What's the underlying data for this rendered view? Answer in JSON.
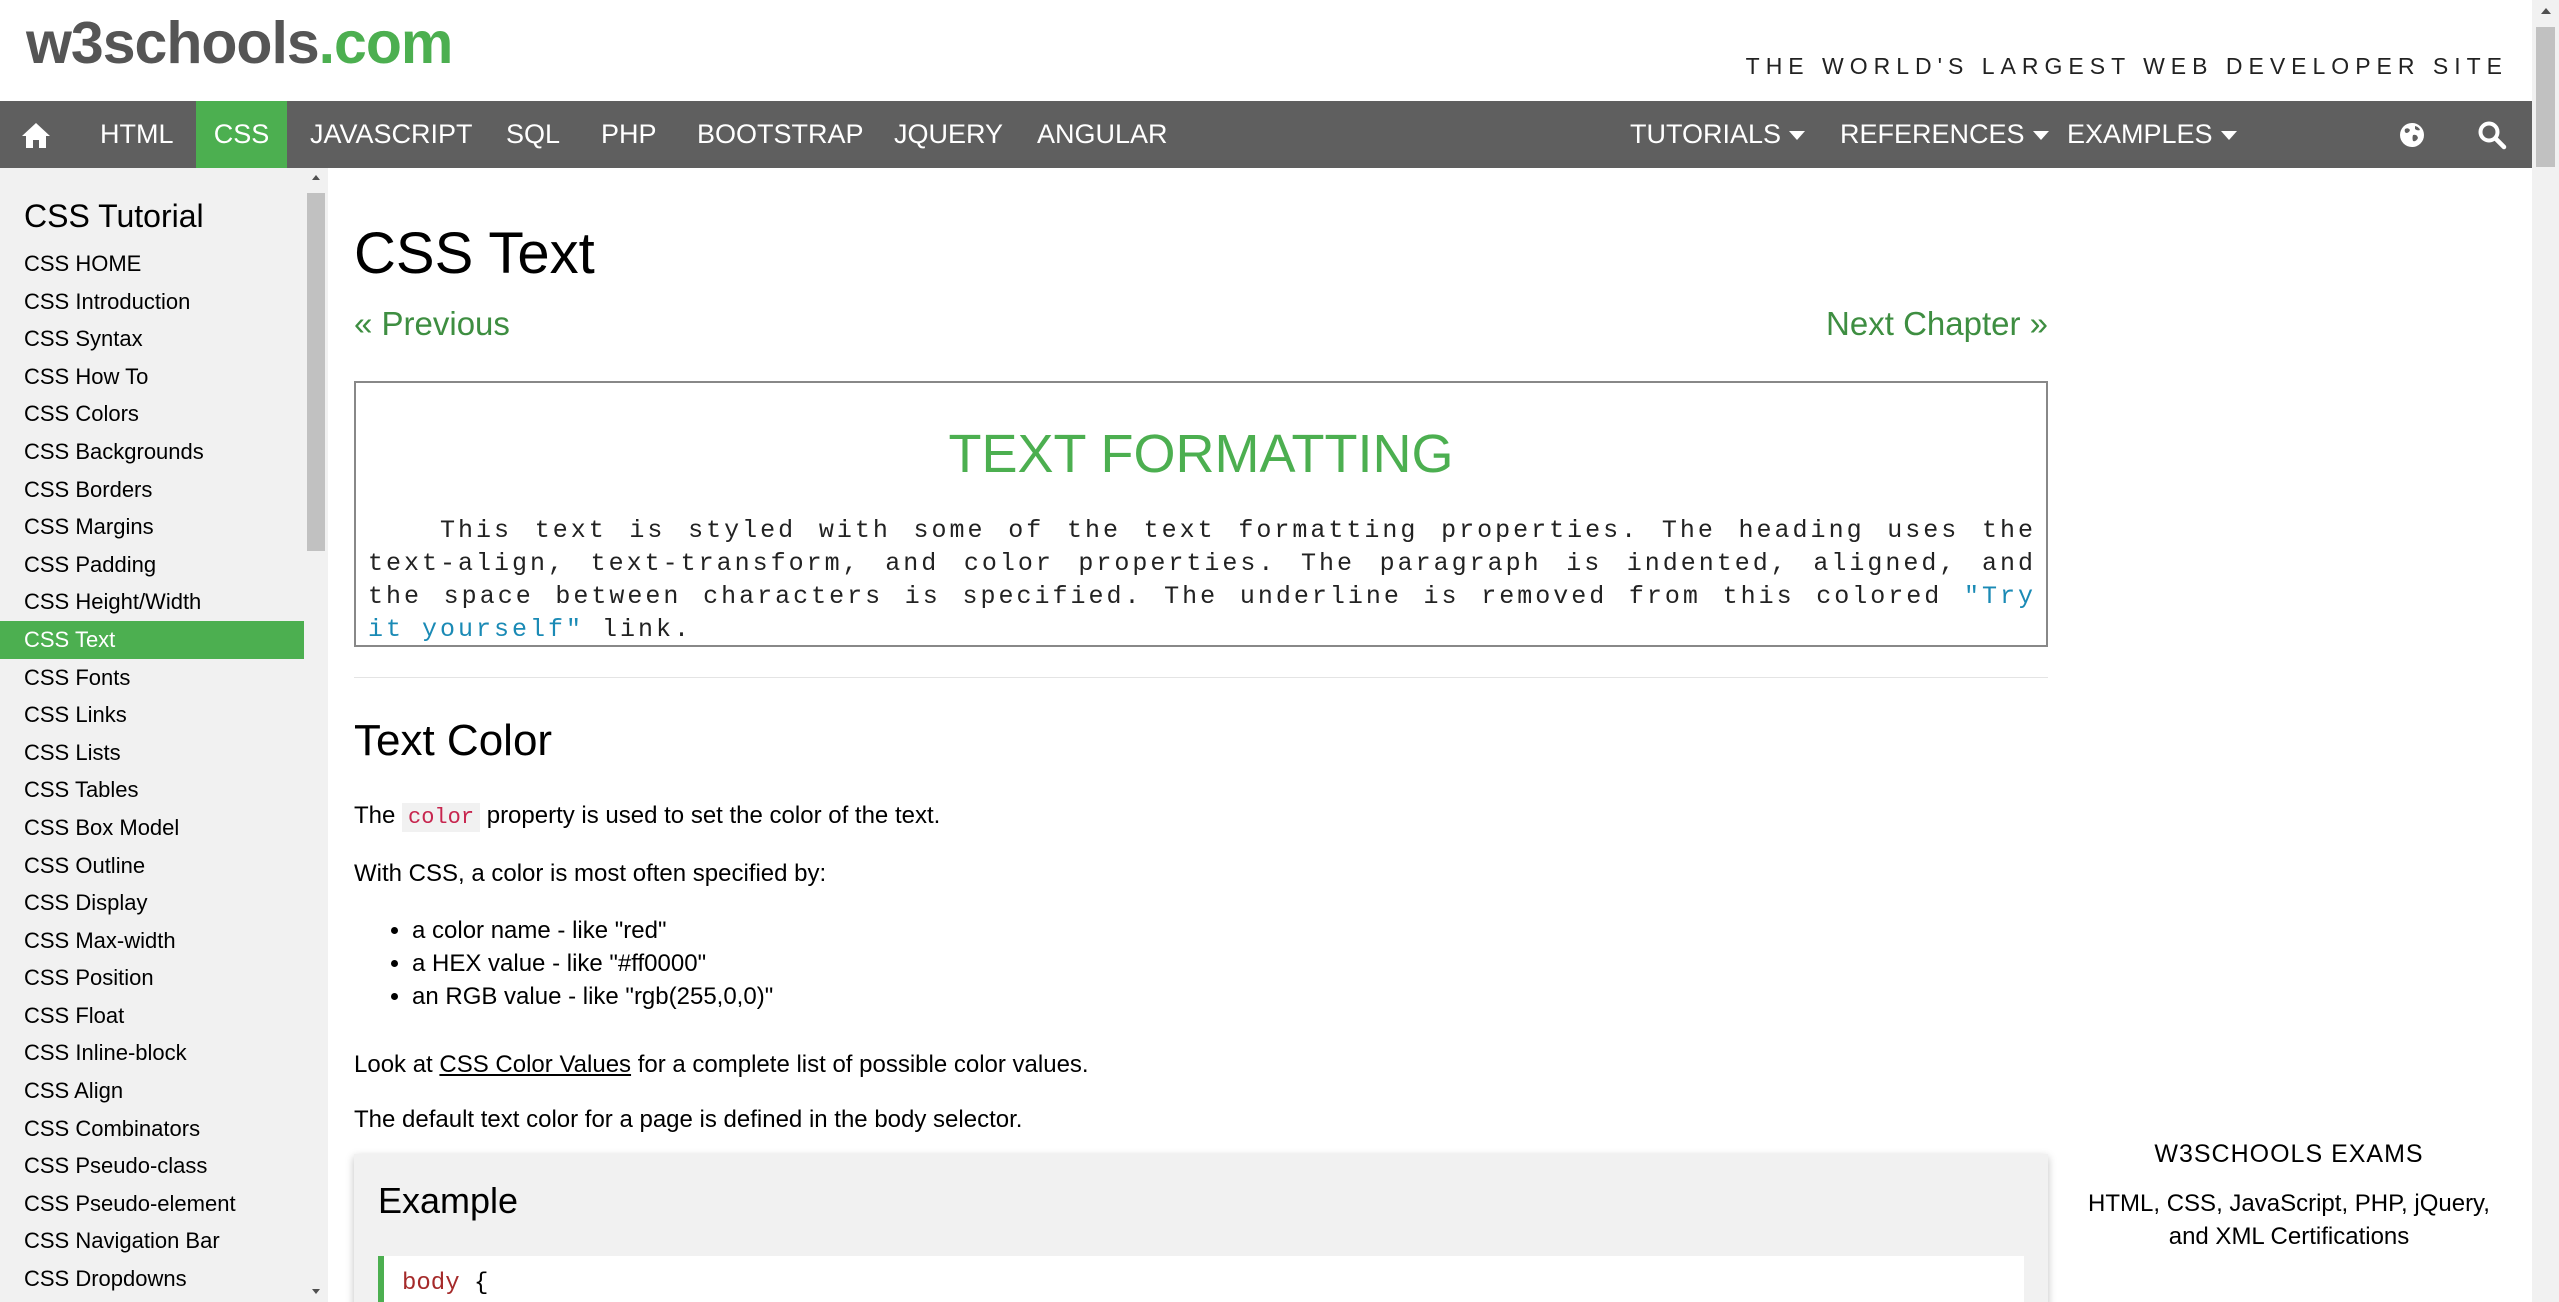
{
  "header": {
    "logo_main": "w3schools",
    "logo_suffix": ".com",
    "tagline": "THE WORLD'S LARGEST WEB DEVELOPER SITE"
  },
  "nav": {
    "home_icon": "home-icon",
    "items": [
      "HTML",
      "CSS",
      "JAVASCRIPT",
      "SQL",
      "PHP",
      "BOOTSTRAP",
      "JQUERY",
      "ANGULAR"
    ],
    "active_item": "CSS",
    "dropdowns": [
      "TUTORIALS",
      "REFERENCES",
      "EXAMPLES"
    ],
    "globe_icon": "globe-icon",
    "search_icon": "search-icon"
  },
  "sidebar": {
    "title": "CSS Tutorial",
    "items": [
      "CSS HOME",
      "CSS Introduction",
      "CSS Syntax",
      "CSS How To",
      "CSS Colors",
      "CSS Backgrounds",
      "CSS Borders",
      "CSS Margins",
      "CSS Padding",
      "CSS Height/Width",
      "CSS Text",
      "CSS Fonts",
      "CSS Links",
      "CSS Lists",
      "CSS Tables",
      "CSS Box Model",
      "CSS Outline",
      "CSS Display",
      "CSS Max-width",
      "CSS Position",
      "CSS Float",
      "CSS Inline-block",
      "CSS Align",
      "CSS Combinators",
      "CSS Pseudo-class",
      "CSS Pseudo-element",
      "CSS Navigation Bar",
      "CSS Dropdowns"
    ],
    "active_item": "CSS Text"
  },
  "main": {
    "title": "CSS Text",
    "prev_label": "« Previous",
    "next_label": "Next Chapter »",
    "demo": {
      "heading": "Text Formatting",
      "text_before": "This text is styled with some of the text formatting properties. The heading uses the text-align, text-transform, and color properties. The paragraph is indented, aligned, and the space between characters is specified. The underline is removed from this colored ",
      "link_text": "\"Try it yourself\"",
      "text_after": " link.",
      "heading_color": "#4CAF50",
      "link_color": "#1a8ab5"
    },
    "section": {
      "title": "Text Color",
      "p1_before": "The ",
      "p1_code": "color",
      "p1_after": " property is used to set the color of the text.",
      "p2": "With CSS, a color is most often specified by:",
      "list": [
        "a color name - like \"red\"",
        "a HEX value - like \"#ff0000\"",
        "an RGB value - like \"rgb(255,0,0)\""
      ],
      "p3_before": "Look at ",
      "p3_link": "CSS Color Values",
      "p3_after": " for a complete list of possible color values.",
      "p4": "The default text color for a page is defined in the body selector."
    },
    "example": {
      "title": "Example",
      "code_selector": "body",
      "code_brace": " {"
    }
  },
  "right_column": {
    "exams_title": "W3SCHOOLS EXAMS",
    "exams_desc_line1": "HTML, CSS, JavaScript, PHP, jQuery,",
    "exams_desc_line2": "and XML Certifications"
  },
  "colors": {
    "accent": "#4CAF50",
    "nav_bg": "#5f5f5f",
    "sidebar_bg": "#f1f1f1"
  }
}
